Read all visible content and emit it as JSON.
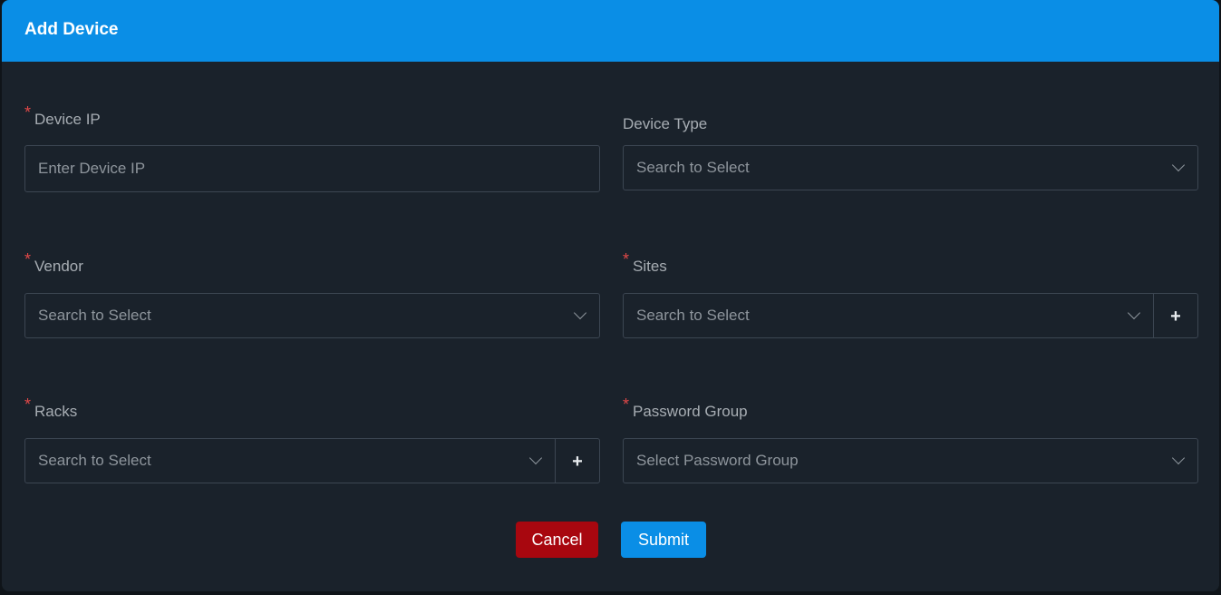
{
  "modal": {
    "title": "Add Device"
  },
  "fields": {
    "device_ip": {
      "label": "Device IP",
      "required": true,
      "placeholder": "Enter Device IP",
      "value": ""
    },
    "device_type": {
      "label": "Device Type",
      "required": false,
      "placeholder": "Search to Select"
    },
    "vendor": {
      "label": "Vendor",
      "required": true,
      "placeholder": "Search to Select"
    },
    "sites": {
      "label": "Sites",
      "required": true,
      "placeholder": "Search to Select",
      "add_label": "+"
    },
    "racks": {
      "label": "Racks",
      "required": true,
      "placeholder": "Search to Select",
      "add_label": "+"
    },
    "password_group": {
      "label": "Password Group",
      "required": true,
      "placeholder": "Select Password Group"
    }
  },
  "required_marker": "*",
  "actions": {
    "cancel_label": "Cancel",
    "submit_label": "Submit"
  },
  "colors": {
    "header": "#0a8ee6",
    "background": "#1a222b",
    "cancel": "#a8070f",
    "submit": "#0a8ee6",
    "required": "#e04848"
  }
}
